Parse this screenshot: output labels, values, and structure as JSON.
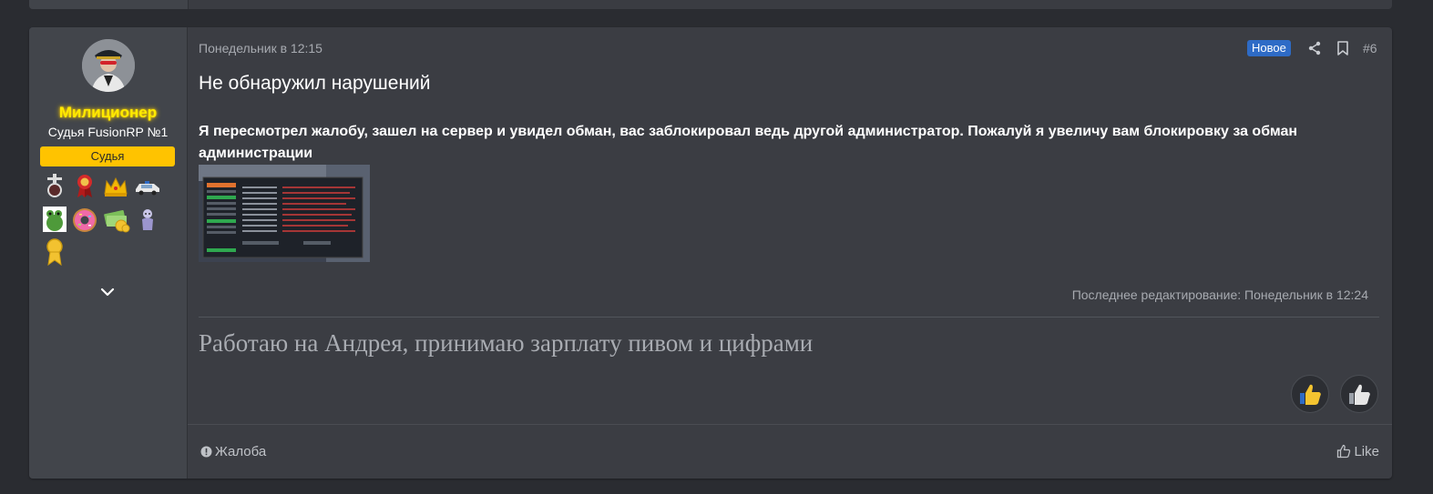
{
  "post": {
    "author": {
      "name": "Милиционер",
      "title": "Судья FusionRP №1",
      "role_banner": "Судья",
      "name_color": "#ffea00",
      "banner_color": "#ffc300",
      "trophies": [
        "medal-cross-icon",
        "red-ribbon-medal-icon",
        "gold-crown-icon",
        "police-car-icon",
        "frog-icon",
        "donut-icon",
        "money-icon",
        "ghost-figure-icon",
        "gold-ribbon-medal-icon"
      ]
    },
    "date": "Понедельник в 12:15",
    "new_badge": "Новое",
    "post_number": "#6",
    "title": "Не обнаружил нарушений",
    "body": "Я пересмотрел жалобу, зашел на сервер и увидел обман, вас заблокировал ведь другой администратор. Пожалуй я увеличу вам блокировку за обман администрации",
    "attachment_icon": "screenshot-thumbnail",
    "last_edit": "Последнее редактирование: Понедельник в 12:24",
    "signature": "Работаю на Андрея, принимаю зарплату пивом и цифрами",
    "reactions": [
      "thumbs-up-icon",
      "thumbs-up-gray-icon"
    ]
  },
  "footer": {
    "report_label": "Жалоба",
    "like_label": "Like"
  },
  "colors": {
    "accent": "#2e6bc6",
    "card_bg": "#3b3d43",
    "sidebar_bg": "#42454b",
    "page_bg": "#2a2c31"
  }
}
